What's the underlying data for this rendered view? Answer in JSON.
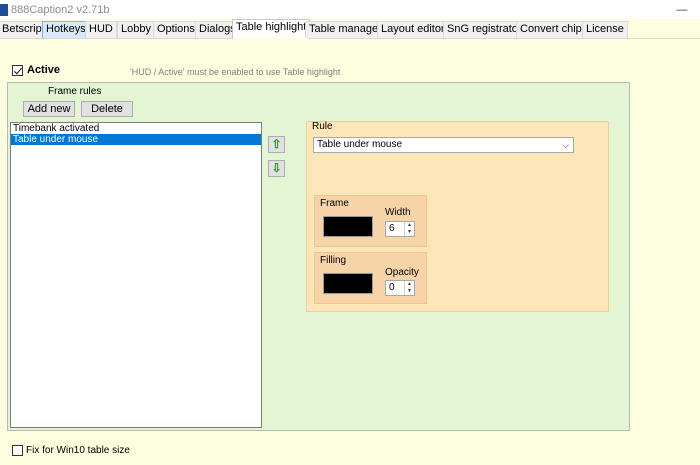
{
  "window": {
    "title": "888Caption2 v2.71b",
    "minimize_glyph": "—"
  },
  "tabs": [
    {
      "label": "Betscript"
    },
    {
      "label": "Hotkeys"
    },
    {
      "label": "HUD"
    },
    {
      "label": "Lobby"
    },
    {
      "label": "Options"
    },
    {
      "label": "Dialogs"
    },
    {
      "label": "Table highlight"
    },
    {
      "label": "Table manager"
    },
    {
      "label": "Layout editor"
    },
    {
      "label": "SnG registrator"
    },
    {
      "label": "Convert chips"
    },
    {
      "label": "License"
    }
  ],
  "active_tab": "Table highlight",
  "active_checkbox": {
    "label": "Active",
    "checked": true
  },
  "hint_text": "'HUD / Active' must be enabled to use Table highlight",
  "frame_rules": {
    "caption": "Frame rules",
    "add_label": "Add new",
    "delete_label": "Delete",
    "items": [
      "Timebank activated",
      "Table under mouse"
    ],
    "selected_index": 1,
    "move_up_glyph": "⇧",
    "move_down_glyph": "⇩"
  },
  "rule": {
    "caption": "Rule",
    "selected": "Table under mouse",
    "dropdown_glyph": "⌵",
    "frame": {
      "caption": "Frame",
      "color": "#000000",
      "width_label": "Width",
      "width_value": "6"
    },
    "filling": {
      "caption": "Filling",
      "color": "#000000",
      "opacity_label": "Opacity",
      "opacity_value": "0"
    }
  },
  "fix_checkbox": {
    "label": "Fix for Win10 table size",
    "checked": false
  },
  "colors": {
    "background": "#fdfde0",
    "panel_green": "#e3f5d3",
    "rule_panel": "#fde7b8",
    "sub_panel": "#f7d3a8",
    "selection": "#0078d7",
    "arrow_green": "#2a9d2a"
  }
}
